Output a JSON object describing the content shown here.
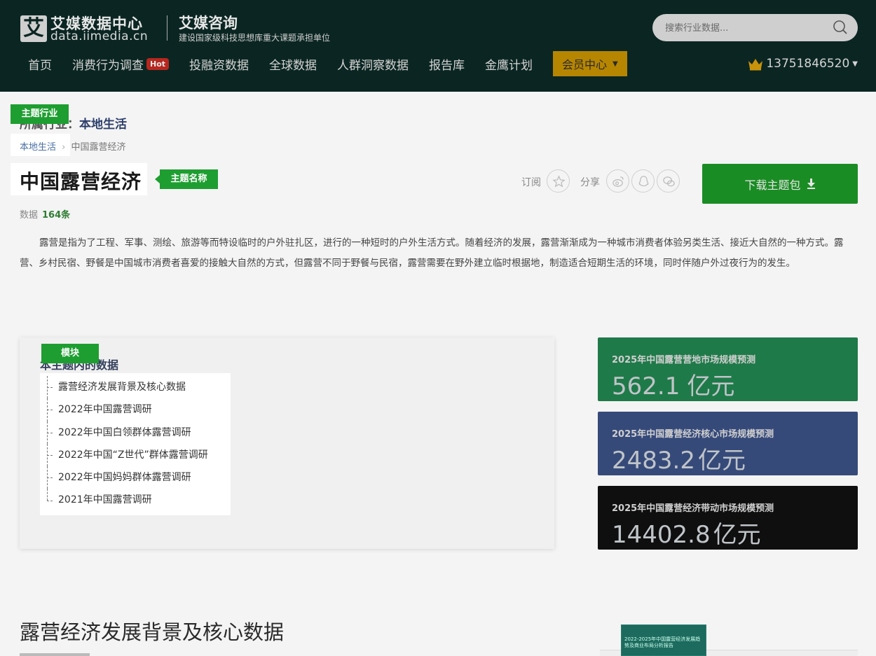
{
  "header": {
    "logo_mark": "艾",
    "logo_title": "艾媒数据中心",
    "logo_domain": "data.iimedia.cn",
    "consult_title": "艾媒咨询",
    "consult_sub": "建设国家级科技思想库重大课题承担单位",
    "search_placeholder": "搜索行业数据...",
    "nav": [
      {
        "label": "首页"
      },
      {
        "label": "消费行为调查",
        "badge": "Hot"
      },
      {
        "label": "投融资数据"
      },
      {
        "label": "全球数据"
      },
      {
        "label": "人群洞察数据"
      },
      {
        "label": "报告库"
      },
      {
        "label": "金鹰计划"
      }
    ],
    "vip_label": "会员中心",
    "user_phone": "13751846520"
  },
  "topic": {
    "tag_industry": "主题行业",
    "industry_prefix": "所属行业：",
    "industry_name": "本地生活",
    "crumb_link": "本地生活",
    "crumb_sep": "›",
    "crumb_current": "中国露营经济",
    "title": "中国露营经济",
    "tag_name": "主题名称",
    "subscribe_label": "订阅",
    "share_label": "分享",
    "download_label": "下载主题包",
    "count_label": "数据",
    "count_value": "164条",
    "description": "露营是指为了工程、军事、测绘、旅游等而特设临时的户外驻扎区，进行的一种短时的户外生活方式。随着经济的发展，露营渐渐成为一种城市消费者体验另类生活、接近大自然的一种方式。露营、乡村民宿、野餐是中国城市消费者喜爱的接触大自然的方式，但露营不同于野餐与民宿，露营需要在野外建立临时根据地，制造适合短期生活的环境，同时伴随户外过夜行为的发生。"
  },
  "module": {
    "tag": "模块",
    "heading": "本主题内的数据",
    "items": [
      "露营经济发展背景及核心数据",
      "2022年中国露营调研",
      "2022年中国白领群体露营调研",
      "2022年中国“Z世代”群体露营调研",
      "2022年中国妈妈群体露营调研",
      "2021年中国露营调研"
    ]
  },
  "stats": [
    {
      "label": "2025年中国露营营地市场规模预测",
      "value": "562.1",
      "unit": "亿元",
      "color": "#1f7a49"
    },
    {
      "label": "2025年中国露营经济核心市场规模预测",
      "value": "2483.2",
      "unit": "亿元",
      "color": "#364a7a"
    },
    {
      "label": "2025年中国露营经济带动市场规模预测",
      "value": "14402.8",
      "unit": "亿元",
      "color": "#0f0f0f"
    }
  ],
  "section": {
    "title": "露营经济发展背景及核心数据",
    "report_thumb_text": "2022-2025年中国露营经济发展趋势及商业布局分析报告"
  },
  "colors": {
    "header_bg": "#0b2622",
    "accent_green": "#1e9e31",
    "vip_gold": "#b78600",
    "hot_red": "#b6271f"
  }
}
